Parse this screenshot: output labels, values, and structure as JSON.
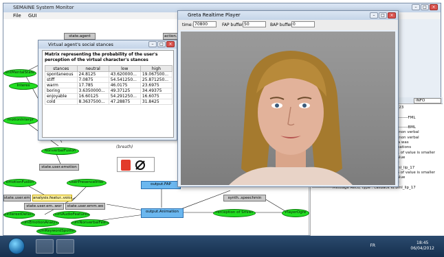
{
  "main_window": {
    "title": "SEMAINE System Monitor",
    "menu": [
      "File",
      "GUI"
    ]
  },
  "graph": {
    "nodes_green": [
      {
        "id": "currentMentalState",
        "label": "entMentalState"
      },
      {
        "id": "interest",
        "label": "Interes"
      },
      {
        "id": "emotionInterp",
        "label": "motionInterpr"
      },
      {
        "id": "nonverbalFusion",
        "label": "NonverbalFusion"
      },
      {
        "id": "emotionFusion",
        "label": "EmotionFusion"
      },
      {
        "id": "userPresence",
        "label": "UserPresenceInter"
      },
      {
        "id": "interestDetector",
        "label": "uInterestDetector"
      },
      {
        "id": "tumAudioFeatures",
        "label": "TumAudioFeatures"
      },
      {
        "id": "tumEmotionAnalysis",
        "label": "TumEmotionAnalysis"
      },
      {
        "id": "tumNonverbal",
        "label": "TumNonverbalFeatu"
      },
      {
        "id": "tumKeywordSpotter",
        "label": "TumKeywordSpotter"
      },
      {
        "id": "perceptionSmiler",
        "label": "Perception of Smiler"
      },
      {
        "id": "playerOgre",
        "label": "PlayerOgre"
      }
    ],
    "boxes_gray": [
      {
        "id": "stateAgent",
        "label": "state.agent"
      },
      {
        "id": "actionA",
        "label": "action.a"
      },
      {
        "id": "stateUserEmotion",
        "label": "state.user.emotion"
      },
      {
        "id": "stateUserEmm1",
        "label": "state.user.emm.v"
      },
      {
        "id": "stateUserEmWor",
        "label": "state.user.em..wor"
      },
      {
        "id": "stateUserEmmWor2",
        "label": "state.user.emm.wo"
      },
      {
        "id": "synthSpeech",
        "label": "synth..speechmin"
      }
    ],
    "boxes_yellow": [
      {
        "id": "analysisVoice",
        "label": "analysis.featur..voice"
      }
    ],
    "boxes_blue": [
      {
        "id": "outputFap",
        "label": "output.FAP"
      },
      {
        "id": "outputAnimation",
        "label": "output.Animation"
      }
    ],
    "breath_label": "(breath)"
  },
  "stances_window": {
    "title": "Virtual agent's social stances",
    "caption": "Matrix representing the probability of the user's perception of the virtual character's stances",
    "columns": [
      "stances",
      "neutral",
      "low",
      "high"
    ],
    "rows": [
      [
        "spontaneous",
        "24.8125",
        "43.620000...",
        "19.067500..."
      ],
      [
        "stiff",
        "7.0875",
        "54.541250...",
        "25.871250..."
      ],
      [
        "warm",
        "17.785",
        "46.0175",
        "23.6975"
      ],
      [
        "boring",
        "3.6350000...",
        "49.37125",
        "34.49375"
      ],
      [
        "enjoyable",
        "16.60125",
        "54.291250...",
        "16.6075"
      ],
      [
        "cold",
        "8.3637500...",
        "47.28875",
        "31.8425"
      ]
    ]
  },
  "greta_window": {
    "title": "Greta Realtime Player",
    "time_label": "time:",
    "time_value": "70800",
    "fap_label": "FAP buffer:",
    "fap_value": "50",
    "bap_label": "BAP buffer:",
    "bap_value": "0"
  },
  "log_panel": {
    "level": "INFO",
    "lines": [
      "bml_uap_23",
      "lip_17",
      "------------------------------FML",
      "lip_17",
      "------------------------------BML",
      "System): non verbal",
      "System): non verbal",
      "n: no data was",
      "ert informations",
      "WARN  semaine.log.EmotionFusion Value -0.11 of value is smaller",
      "than minimum 0.0 -- trimming to minimum value",
      "INFO  semaine.log.Perception of Smiling Agent",
      "---------------Message Recu, type : callback id:fml_lip_17",
      "WARN  semaine.log.EmotionFusion Value -0.06 of value is smaller",
      "than minimum 0.0 -- trimming to minimum value",
      "INFO  semaine.log.Perception of Smiling Agent",
      "---------------Message Recu, type : callback id:bml_lip_17"
    ]
  },
  "taskbar": {
    "lang": "FR",
    "time": "18:45",
    "date": "06/04/2012"
  }
}
